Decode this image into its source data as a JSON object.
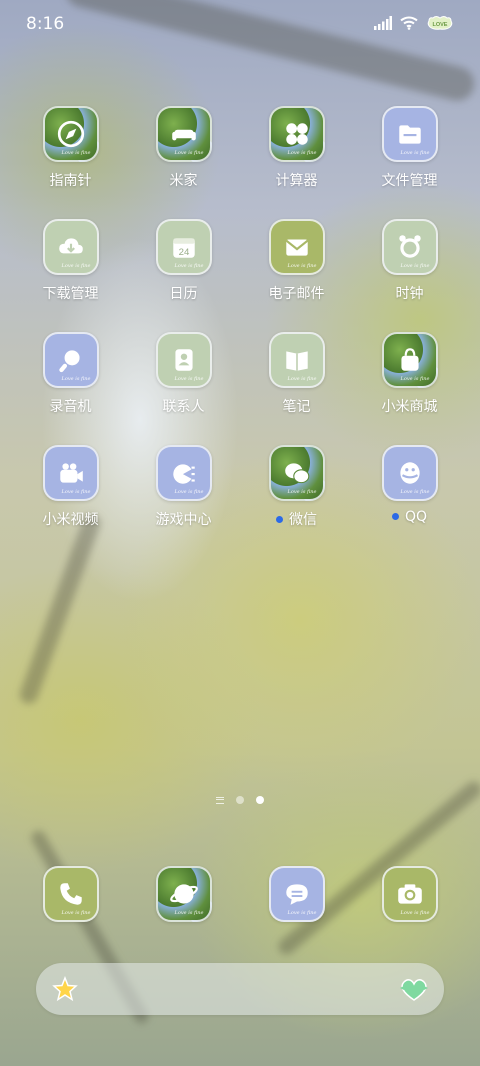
{
  "status_bar": {
    "time": "8:16",
    "battery_label": "LOVE"
  },
  "icon_tag": "Love is fine",
  "apps": [
    {
      "label": "指南针",
      "style": "photo",
      "icon": "compass-icon",
      "dot": false
    },
    {
      "label": "米家",
      "style": "photo",
      "icon": "sofa-icon",
      "dot": false
    },
    {
      "label": "计算器",
      "style": "photo",
      "icon": "calculator-icon",
      "dot": false
    },
    {
      "label": "文件管理",
      "style": "blue",
      "icon": "folder-icon",
      "dot": false
    },
    {
      "label": "下载管理",
      "style": "mint",
      "icon": "cloud-download-icon",
      "dot": false
    },
    {
      "label": "日历",
      "style": "mint",
      "icon": "calendar-icon",
      "dot": false,
      "date": "24"
    },
    {
      "label": "电子邮件",
      "style": "green",
      "icon": "mail-icon",
      "dot": false
    },
    {
      "label": "时钟",
      "style": "mint",
      "icon": "alarm-clock-icon",
      "dot": false
    },
    {
      "label": "录音机",
      "style": "blue",
      "icon": "recorder-icon",
      "dot": false
    },
    {
      "label": "联系人",
      "style": "mint",
      "icon": "contacts-icon",
      "dot": false
    },
    {
      "label": "笔记",
      "style": "mint",
      "icon": "notebook-icon",
      "dot": false
    },
    {
      "label": "小米商城",
      "style": "photo",
      "icon": "shopping-bag-icon",
      "dot": false
    },
    {
      "label": "小米视频",
      "style": "blue",
      "icon": "video-camera-icon",
      "dot": false
    },
    {
      "label": "游戏中心",
      "style": "blue",
      "icon": "game-center-icon",
      "dot": false
    },
    {
      "label": "微信",
      "style": "photo",
      "icon": "wechat-icon",
      "dot": true
    },
    {
      "label": "QQ",
      "style": "blue",
      "icon": "qq-penguin-icon",
      "dot": true
    }
  ],
  "dock": [
    {
      "style": "green",
      "icon": "phone-icon"
    },
    {
      "style": "photo",
      "icon": "browser-globe-icon"
    },
    {
      "style": "blue",
      "icon": "messages-icon"
    },
    {
      "style": "green",
      "icon": "camera-icon"
    }
  ],
  "pager": {
    "pages": 2,
    "active": 2
  },
  "colors": {
    "notification_dot": "#2c6ae6",
    "icon_blue": "#a6b4e3",
    "icon_green": "#a9b868",
    "icon_mint": "#bfd0b2"
  }
}
